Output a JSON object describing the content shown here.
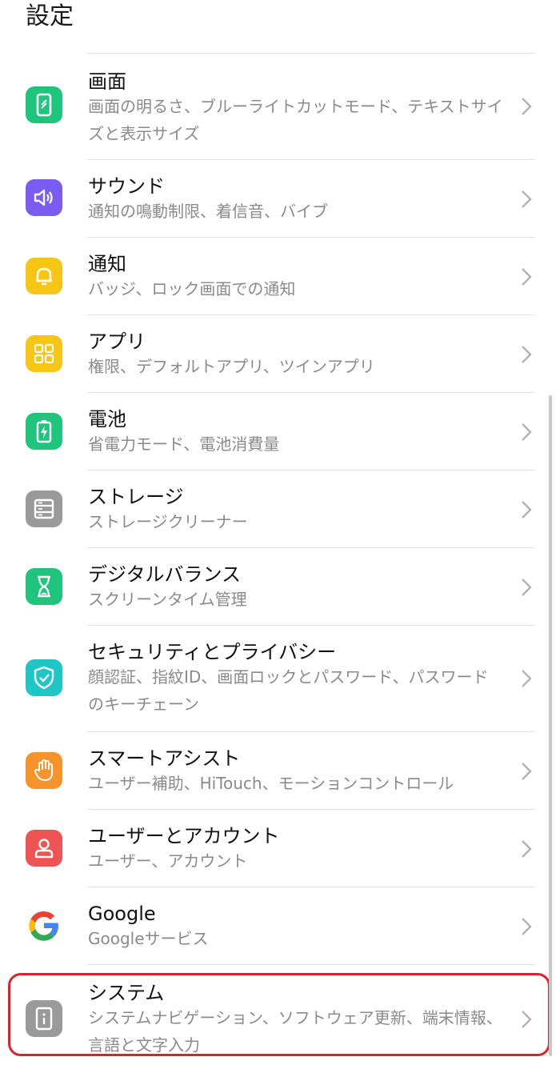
{
  "header": {
    "title": "設定"
  },
  "items": [
    {
      "title": "画面",
      "subtitle": "画面の明るさ、ブルーライトカットモード、テキストサイズと表示サイズ",
      "color": "#1fc47d"
    },
    {
      "title": "サウンド",
      "subtitle": "通知の鳴動制限、着信音、バイブ",
      "color": "#7a5cf2"
    },
    {
      "title": "通知",
      "subtitle": "バッジ、ロック画面での通知",
      "color": "#f7c514"
    },
    {
      "title": "アプリ",
      "subtitle": "権限、デフォルトアプリ、ツインアプリ",
      "color": "#f7c514"
    },
    {
      "title": "電池",
      "subtitle": "省電力モード、電池消費量",
      "color": "#1fc47d"
    },
    {
      "title": "ストレージ",
      "subtitle": "ストレージクリーナー",
      "color": "#9a9a9a"
    },
    {
      "title": "デジタルバランス",
      "subtitle": "スクリーンタイム管理",
      "color": "#1fc47d"
    },
    {
      "title": "セキュリティとプライバシー",
      "subtitle": "顔認証、指紋ID、画面ロックとパスワード、パスワードのキーチェーン",
      "color": "#1ec6c6"
    },
    {
      "title": "スマートアシスト",
      "subtitle": "ユーザー補助、HiTouch、モーションコントロール",
      "color": "#f6932a"
    },
    {
      "title": "ユーザーとアカウント",
      "subtitle": "ユーザー、アカウント",
      "color": "#ee5454"
    },
    {
      "title": "Google",
      "subtitle": "Googleサービス",
      "color": "#ffffff"
    },
    {
      "title": "システム",
      "subtitle": "システムナビゲーション、ソフトウェア更新、端末情報、言語と文字入力",
      "color": "#9a9a9a"
    }
  ]
}
